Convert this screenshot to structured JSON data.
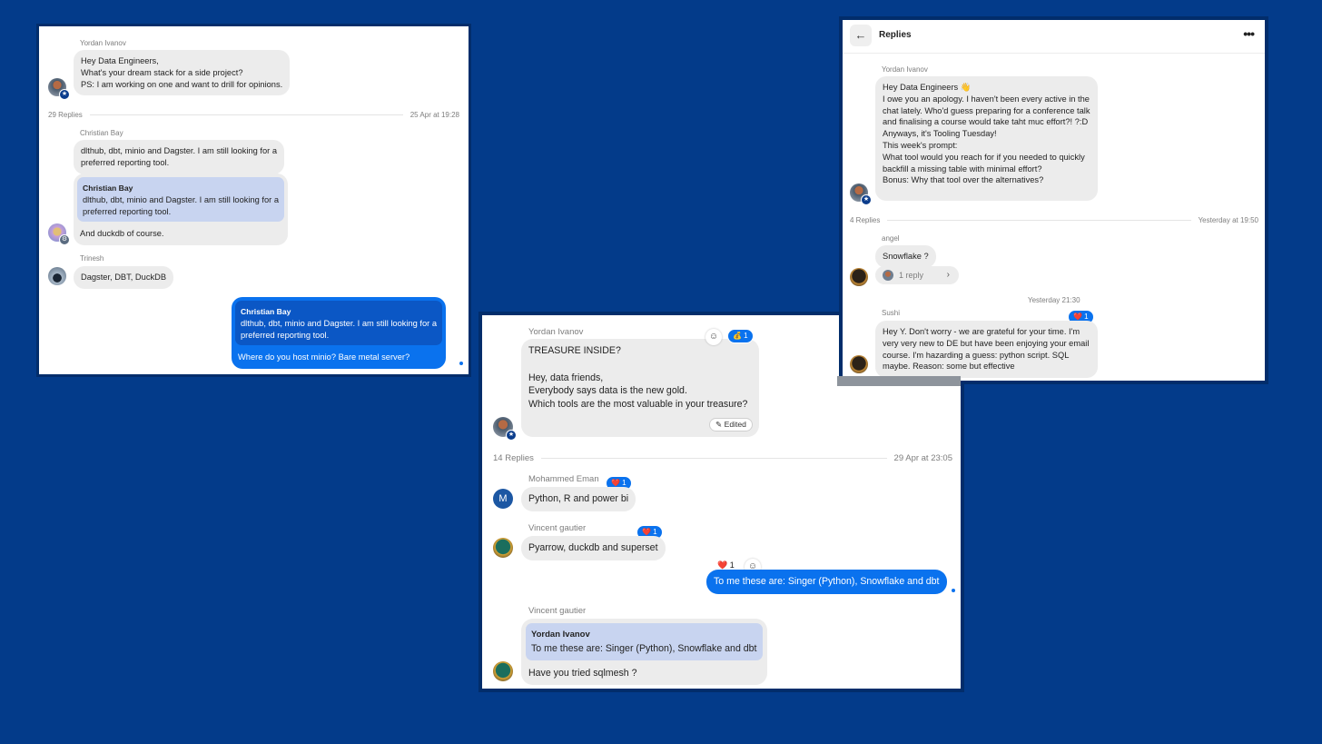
{
  "panel1": {
    "msg1": {
      "author": "Yordan Ivanov",
      "lines": [
        "Hey Data Engineers,",
        "What's your dream stack for a side project?",
        "PS: I am working on one and want to drill for opinions."
      ]
    },
    "divider": {
      "replies": "29 Replies",
      "time": "25 Apr at 19:28"
    },
    "msg2": {
      "author": "Christian Bay",
      "lines": [
        "dlthub, dbt, minio and Dagster. I am still looking for a",
        "preferred reporting tool."
      ]
    },
    "msg3": {
      "quote_author": "Christian Bay",
      "quote_lines": [
        "dlthub, dbt, minio and Dagster. I am still looking for a",
        "preferred reporting tool."
      ],
      "text": "And duckdb of course."
    },
    "msg4": {
      "author": "Trinesh",
      "text": "Dagster, DBT, DuckDB"
    },
    "msg5": {
      "quote_author": "Christian Bay",
      "quote_lines": [
        "dlthub, dbt, minio and Dagster. I am still looking for a",
        "preferred reporting tool."
      ],
      "text": "Where do you host minio? Bare metal server?"
    }
  },
  "panel2": {
    "msg1": {
      "author": "Yordan Ivanov",
      "lines": [
        "TREASURE INSIDE?",
        "",
        "Hey, data friends,",
        "Everybody says data is the new gold.",
        "Which tools are the most valuable in your treasure?"
      ],
      "reaction": "💰 1",
      "edited": "Edited"
    },
    "divider": {
      "replies": "14 Replies",
      "time": "29 Apr at 23:05"
    },
    "msg2": {
      "author": "Mohammed Eman",
      "avatar_letter": "M",
      "text": "Python, R and power bi",
      "reaction": "❤️ 1"
    },
    "msg3": {
      "author": "Vincent gautier",
      "text": "Pyarrow, duckdb and superset",
      "reaction": "❤️ 1"
    },
    "msg4": {
      "text": "To me these are: Singer (Python), Snowflake and dbt",
      "reaction": "❤️ 1"
    },
    "msg5": {
      "author": "Vincent gautier",
      "quote_author": "Yordan Ivanov",
      "quote_text": "To me these are: Singer (Python), Snowflake and dbt",
      "text": "Have you tried sqlmesh ?"
    }
  },
  "panel3": {
    "header": {
      "title": "Replies"
    },
    "msg1": {
      "author": "Yordan Ivanov",
      "lines": [
        "Hey Data Engineers 👋",
        "I owe you an apology. I haven't been every active in the chat lately. Who'd guess preparing for a conference talk and finalising a course would take taht muc effort?! ?:D",
        "Anyways, it's Tooling Tuesday!",
        "This week's prompt:",
        "What tool would you reach for if you needed to quickly backfill a missing table with minimal effort?",
        "Bonus: Why that tool over the alternatives?"
      ]
    },
    "divider": {
      "replies": "4 Replies",
      "time": "Yesterday at 19:50"
    },
    "msg2": {
      "author": "angel",
      "text": "Snowflake ?",
      "reply_count": "1 reply"
    },
    "time2": "Yesterday 21:30",
    "msg3": {
      "author": "Sushi",
      "text": "Hey Y. Don't worry - we are grateful for your time. I'm very very new to DE but have been enjoying your email course. I'm hazarding a guess: python script. SQL maybe. Reason: some but effective",
      "reaction": "❤️ 1"
    }
  }
}
